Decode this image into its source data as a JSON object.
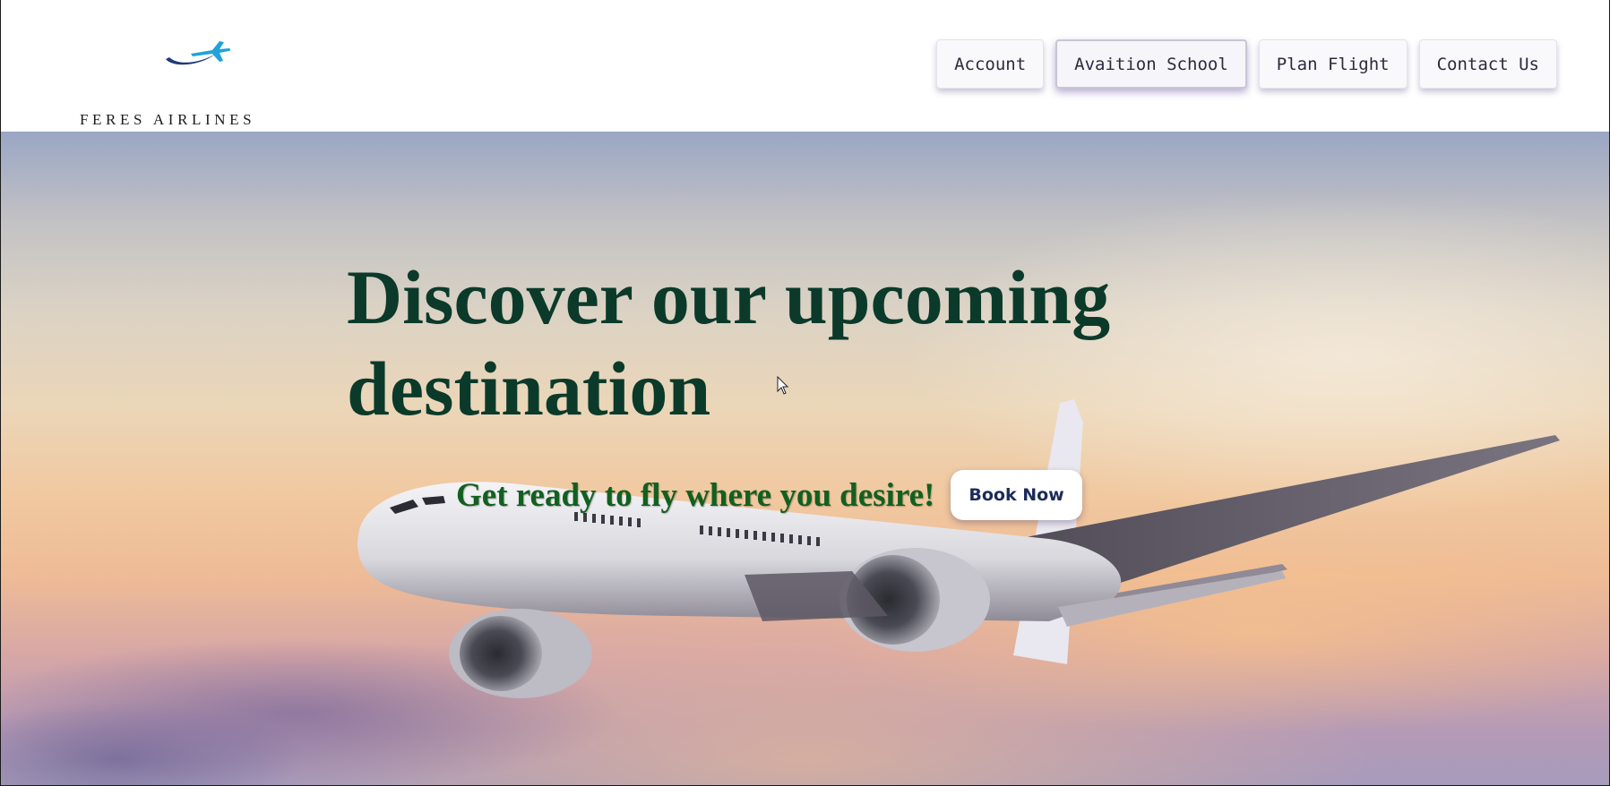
{
  "header": {
    "brand_name": "FERES AIRLINES",
    "logo_icon": "airplane-swoosh-icon"
  },
  "nav": {
    "items": [
      {
        "label": "Account",
        "active": false
      },
      {
        "label": "Avaition School",
        "active": true
      },
      {
        "label": "Plan Flight",
        "active": false
      },
      {
        "label": "Contact Us",
        "active": false
      }
    ]
  },
  "hero": {
    "title": "Discover our upcoming destination",
    "subtitle": "Get ready to fly where you desire!",
    "cta_label": "Book Now",
    "background": "sunset-sky-with-airliner"
  },
  "colors": {
    "title": "#0b3a2a",
    "subtitle": "#12601f",
    "cta_text": "#1c2b5a",
    "logo_plane": "#1fa3d8",
    "logo_swoosh": "#1d3a78"
  }
}
